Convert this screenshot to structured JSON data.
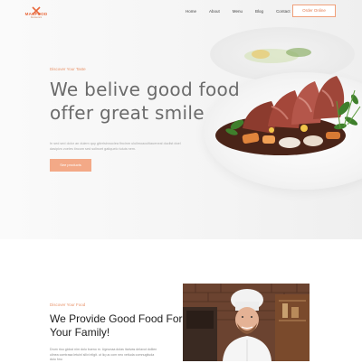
{
  "header": {
    "logo_text": "MAKFOOD",
    "logo_sub": "Restaurant",
    "nav": [
      "Home",
      "About",
      "Menu",
      "Blog",
      "Contact"
    ],
    "order_button": "Order Online"
  },
  "hero": {
    "subtitle": "Discover Your Taste",
    "title_line1": "We belive good food",
    "title_line2": "offer great smile",
    "description": "In sed sed dolor an duiem quy gitvrisinnuclea fincinm uluilmoacultiaueneal duclist doel dasipivs voeles tincom sed solincet gatiquelo tuluis nem.",
    "button": "See products"
  },
  "about": {
    "subtitle": "Discover Your Food",
    "title": "We Provide Good Food For Your Family!",
    "description": "Drum riou gidoci nim dolu bueno m. Ugnunaa dolas itarivas delavot dollien ulinea comtrasa letuinl silivi eligit. ut liq us com neo vetiuda comnugituda duiu hnu"
  },
  "colors": {
    "accent": "#f3a987",
    "accent_text": "#e8936a",
    "title_gray": "#6b6b6b"
  }
}
